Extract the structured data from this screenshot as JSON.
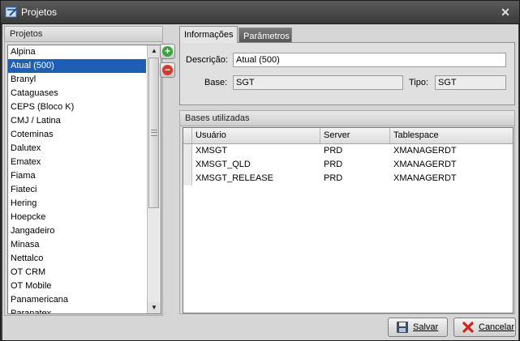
{
  "window": {
    "title": "Projetos"
  },
  "left_panel": {
    "header": "Projetos",
    "items": [
      "Alpina",
      "Atual (500)",
      "Branyl",
      "Cataguases",
      "CEPS (Bloco K)",
      "CMJ / Latina",
      "Coteminas",
      "Dalutex",
      "Ematex",
      "Fiama",
      "Fiateci",
      "Hering",
      "Hoepcke",
      "Jangadeiro",
      "Minasa",
      "Nettalco",
      "OT CRM",
      "OT Mobile",
      "Panamericana",
      "Paranatex"
    ],
    "selected_index": 1
  },
  "tabs": [
    {
      "label": "Informações"
    },
    {
      "label": "Parâmetros"
    }
  ],
  "info": {
    "descricao_label": "Descrição:",
    "descricao_value": "Atual (500)",
    "base_label": "Base:",
    "base_value": "SGT",
    "tipo_label": "Tipo:",
    "tipo_value": "SGT"
  },
  "bases": {
    "header": "Bases utilizadas",
    "columns": [
      "Usuário",
      "Server",
      "Tablespace"
    ],
    "rows": [
      {
        "usuario": "XMSGT",
        "server": "PRD",
        "tablespace": "XMANAGERDT"
      },
      {
        "usuario": "XMSGT_QLD",
        "server": "PRD",
        "tablespace": "XMANAGERDT"
      },
      {
        "usuario": "XMSGT_RELEASE",
        "server": "PRD",
        "tablespace": "XMANAGERDT"
      }
    ]
  },
  "buttons": {
    "save": "Salvar",
    "cancel": "Cancelar"
  },
  "icons": {
    "add": "add-circle-icon",
    "remove": "remove-circle-icon",
    "close": "close-icon",
    "save": "floppy-disk-icon",
    "cancel": "red-x-icon"
  },
  "colors": {
    "selection": "#1e5fb4",
    "add": "#3aa63a",
    "remove": "#d23b2e",
    "title_bar": "#4a4a4a"
  }
}
